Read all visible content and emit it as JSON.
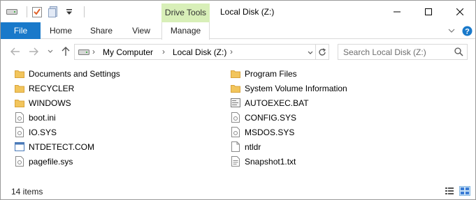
{
  "window": {
    "title": "Local Disk (Z:)",
    "context_tab_group": "Drive Tools"
  },
  "ribbon": {
    "tabs": [
      {
        "label": "File"
      },
      {
        "label": "Home"
      },
      {
        "label": "Share"
      },
      {
        "label": "View"
      },
      {
        "label": "Manage"
      }
    ]
  },
  "address": {
    "crumbs": [
      "My Computer",
      "Local Disk (Z:)"
    ]
  },
  "search": {
    "placeholder": "Search Local Disk (Z:)"
  },
  "files": {
    "left": [
      {
        "name": "Documents and Settings",
        "icon": "folder-icon"
      },
      {
        "name": "RECYCLER",
        "icon": "folder-icon"
      },
      {
        "name": "WINDOWS",
        "icon": "folder-icon"
      },
      {
        "name": "boot.ini",
        "icon": "settings-file-icon"
      },
      {
        "name": "IO.SYS",
        "icon": "settings-file-icon"
      },
      {
        "name": "NTDETECT.COM",
        "icon": "application-icon"
      },
      {
        "name": "pagefile.sys",
        "icon": "settings-file-icon"
      }
    ],
    "right": [
      {
        "name": "Program Files",
        "icon": "folder-icon"
      },
      {
        "name": "System Volume Information",
        "icon": "folder-icon"
      },
      {
        "name": "AUTOEXEC.BAT",
        "icon": "batch-file-icon"
      },
      {
        "name": "CONFIG.SYS",
        "icon": "settings-file-icon"
      },
      {
        "name": "MSDOS.SYS",
        "icon": "settings-file-icon"
      },
      {
        "name": "ntldr",
        "icon": "file-icon"
      },
      {
        "name": "Snapshot1.txt",
        "icon": "text-file-icon"
      }
    ]
  },
  "status": {
    "item_count": "14 items"
  },
  "colors": {
    "file_tab": "#1979ca",
    "context_band": "#d8efb8",
    "folder": "#f2c55c",
    "help": "#1979ca"
  }
}
